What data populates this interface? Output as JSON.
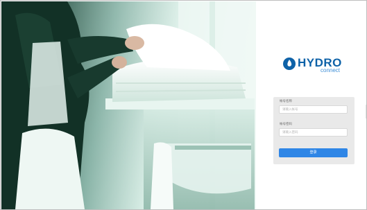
{
  "brand": {
    "name": "HYDRO",
    "tagline": "connect",
    "mark_color": "#0e62a8",
    "accent_color": "#3f8fd6"
  },
  "login": {
    "username_label": "帐号名称",
    "username_placeholder": "请输入帐号",
    "password_label": "帐号密码",
    "password_placeholder": "请输入密码",
    "submit_label": "登录",
    "button_color": "#2f86e6"
  },
  "hero": {
    "subject": "housekeeper folding white towels on a service cart"
  }
}
